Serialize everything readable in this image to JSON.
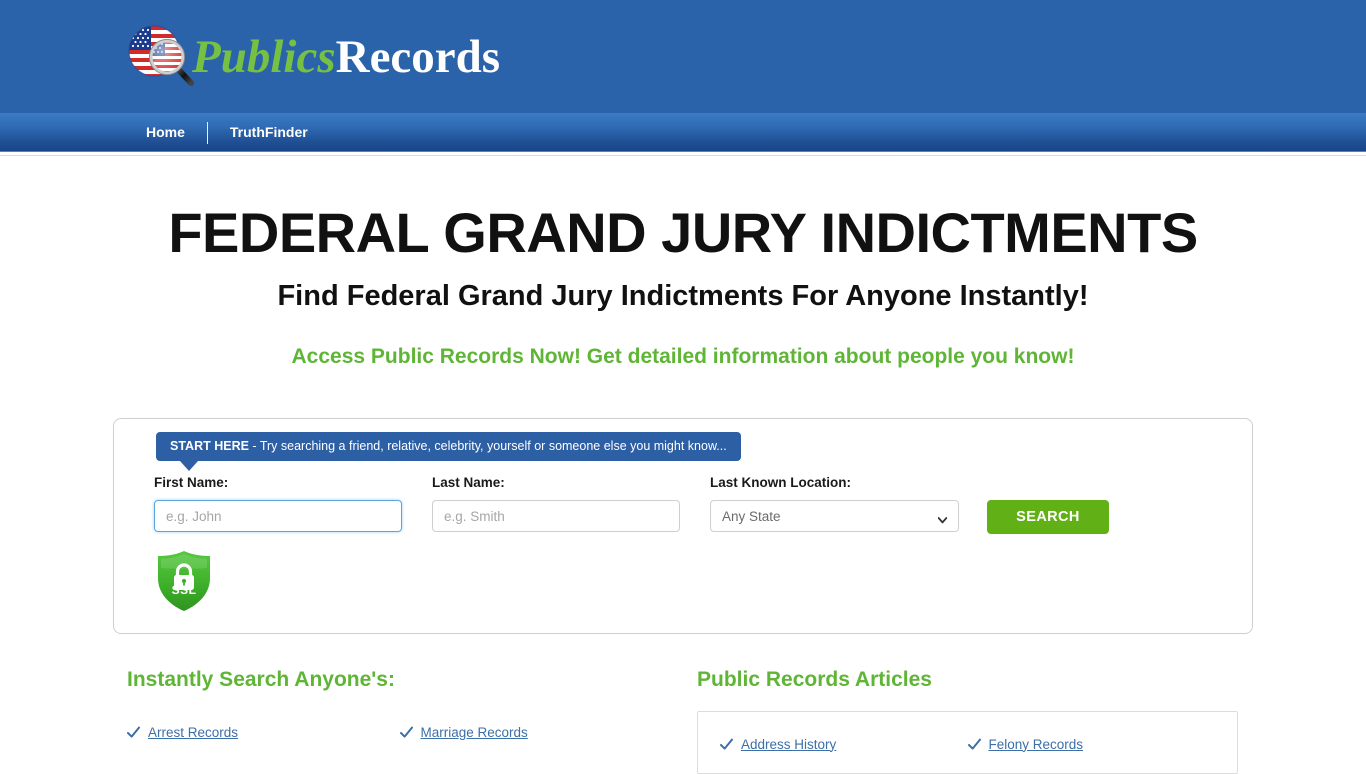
{
  "header": {
    "logo": {
      "icon": "us-flag-magnifier-icon",
      "text_green": "Publics",
      "text_white": "Records"
    },
    "nav": [
      {
        "label": "Home"
      },
      {
        "label": "TruthFinder"
      }
    ]
  },
  "hero": {
    "title": "FEDERAL GRAND JURY INDICTMENTS",
    "subtitle": "Find Federal Grand Jury Indictments For Anyone Instantly!",
    "tagline": "Access Public Records Now! Get detailed information about people you know!"
  },
  "search": {
    "start_here_bold": "START HERE",
    "start_here_rest": " - Try searching a friend, relative, celebrity, yourself or someone else you might know...",
    "first_name_label": "First Name:",
    "first_name_value": "",
    "first_name_placeholder": "e.g. John",
    "last_name_label": "Last Name:",
    "last_name_value": "",
    "last_name_placeholder": "e.g. Smith",
    "location_label": "Last Known Location:",
    "location_selected": "Any State",
    "location_options": [
      "Any State"
    ],
    "search_button": "SEARCH",
    "ssl_badge_label": "SSL",
    "ssl_badge_icon": "padlock-shield-icon"
  },
  "instant_search": {
    "heading": "Instantly Search Anyone's:",
    "links": [
      "Arrest Records",
      "Marriage Records"
    ]
  },
  "articles": {
    "heading": "Public Records Articles",
    "links": [
      "Address History",
      "Felony Records"
    ]
  },
  "colors": {
    "header_blue": "#2b63ab",
    "nav_blue_top": "#3a7cc4",
    "nav_blue_bottom": "#1b458a",
    "brand_green": "#76c043",
    "heading_green": "#5fb536",
    "button_green": "#61b016",
    "link_blue": "#3d6fa8",
    "banner_blue": "#2c5fa4"
  }
}
